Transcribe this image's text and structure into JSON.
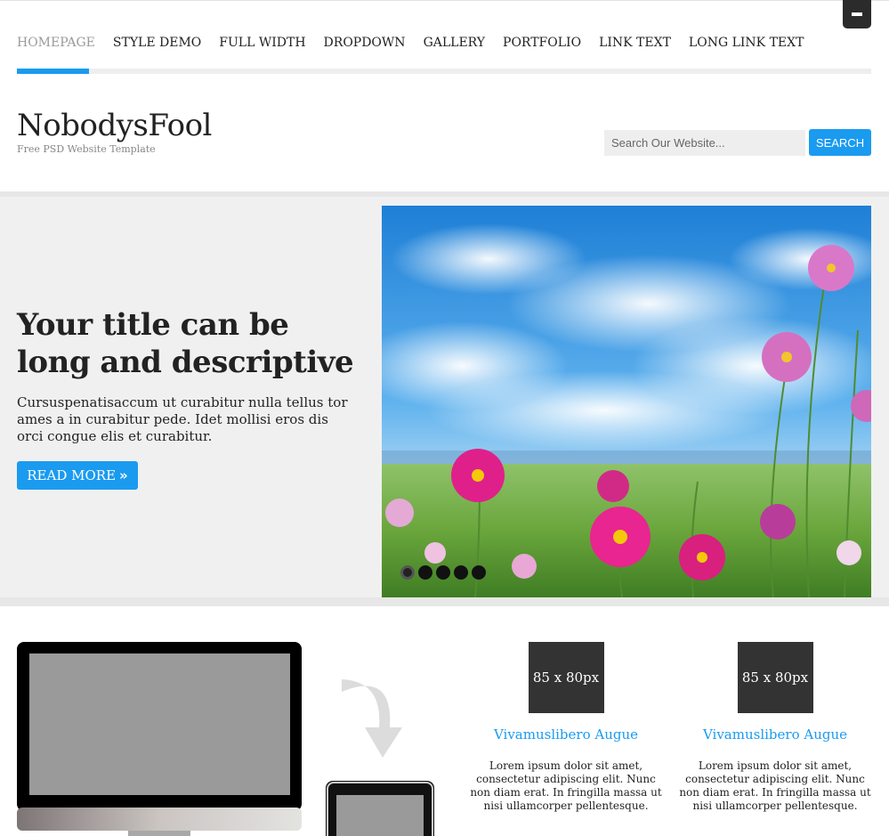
{
  "nav": {
    "items": [
      {
        "label": "HOMEPAGE"
      },
      {
        "label": "STYLE DEMO"
      },
      {
        "label": "FULL WIDTH"
      },
      {
        "label": "DROPDOWN"
      },
      {
        "label": "GALLERY"
      },
      {
        "label": "PORTFOLIO"
      },
      {
        "label": "LINK TEXT"
      },
      {
        "label": "LONG LINK TEXT"
      }
    ],
    "active_index": 0,
    "menu_toggle_icon": "minus-icon"
  },
  "header": {
    "site_title": "NobodysFool",
    "tagline": "Free PSD Website Template"
  },
  "search": {
    "placeholder": "Search Our Website...",
    "button_label": "SEARCH"
  },
  "hero": {
    "title": "Your title can be long and descriptive",
    "text": "Cursuspenatisaccum ut curabitur nulla tellus tor ames a in curabitur pede. Idet mollisi eros dis orci congue elis et curabitur.",
    "button_label": "READ MORE",
    "button_icon": "double-chevron-right-icon",
    "slide_image": "flower-meadow-image",
    "slide_count": 5,
    "active_slide": 0
  },
  "features": [
    {
      "thumb_label": "85 x 80px",
      "title": "Vivamuslibero Augue",
      "text": "Lorem ipsum dolor sit amet, consectetur adipiscing elit. Nunc non diam erat. In fringilla massa ut nisi ullamcorper pellentesque."
    },
    {
      "thumb_label": "85 x 80px",
      "title": "Vivamuslibero Augue",
      "text": "Lorem ipsum dolor sit amet, consectetur adipiscing elit. Nunc non diam erat. In fringilla massa ut nisi ullamcorper pellentesque."
    }
  ],
  "colors": {
    "accent": "#1a9bf0",
    "dark": "#2b2b2b",
    "hero_bg": "#f0f0f0"
  }
}
